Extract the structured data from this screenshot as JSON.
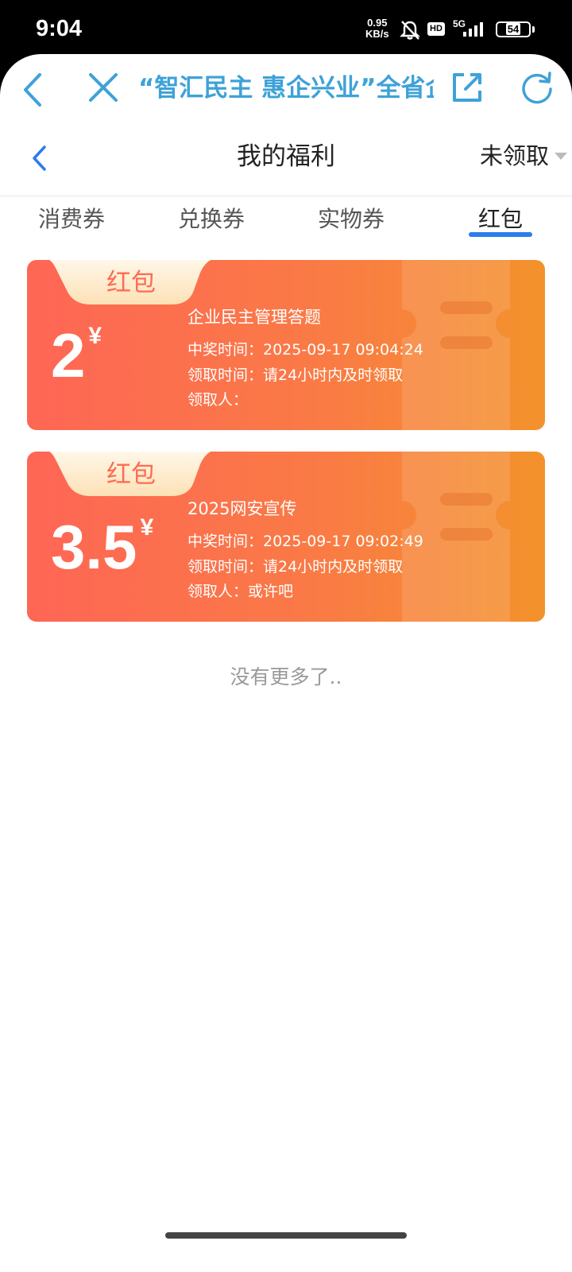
{
  "status_bar": {
    "time": "9:04",
    "net_speed_top": "0.95",
    "net_speed_bottom": "KB/s",
    "hd_label": "HD",
    "network": "5G",
    "battery": "54"
  },
  "browser": {
    "title": "“智汇民主 惠企兴业”全省企业民主管理知识竞赛",
    "icons": [
      "back-icon",
      "close-icon",
      "share-icon",
      "refresh-icon"
    ],
    "accent_color": "#3ea2d8"
  },
  "header": {
    "title": "我的福利",
    "filter_label": "未领取"
  },
  "tabs": [
    {
      "label": "消费券",
      "active": false
    },
    {
      "label": "兑换券",
      "active": false
    },
    {
      "label": "实物券",
      "active": false
    },
    {
      "label": "红包",
      "active": true
    }
  ],
  "cards": [
    {
      "tag": "红包",
      "amount": "2",
      "currency": "¥",
      "name": "企业民主管理答题",
      "win_time": "中奖时间：2025-09-17 09:04:24",
      "claim_time": "领取时间：请24小时内及时领取",
      "claimer": "领取人："
    },
    {
      "tag": "红包",
      "amount": "3.5",
      "currency": "¥",
      "name": "2025网安宣传",
      "win_time": "中奖时间：2025-09-17 09:02:49",
      "claim_time": "领取时间：请24小时内及时领取",
      "claimer": "领取人：或许吧"
    }
  ],
  "footer_text": "没有更多了..",
  "colors": {
    "card_start": "#fe6655",
    "card_end": "#f3922c",
    "tab_underline": "#2b7de9"
  }
}
